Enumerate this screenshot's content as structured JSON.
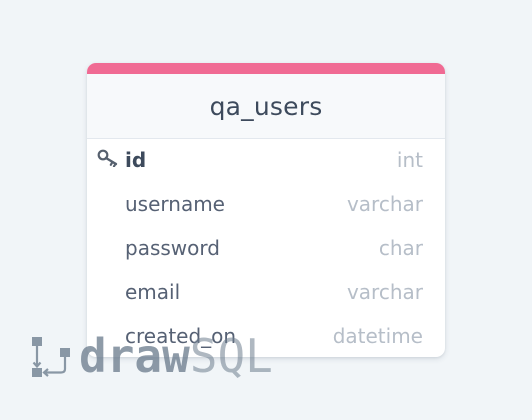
{
  "table": {
    "name": "qa_users",
    "accent_color": "#f06a93",
    "columns": [
      {
        "name": "id",
        "type": "int",
        "primary_key": true,
        "icon": "key-icon"
      },
      {
        "name": "username",
        "type": "varchar"
      },
      {
        "name": "password",
        "type": "char"
      },
      {
        "name": "email",
        "type": "varchar"
      },
      {
        "name": "created_on",
        "type": "datetime"
      }
    ]
  },
  "watermark": {
    "brand_bold": "draw",
    "brand_light": "SQL",
    "icon": "drawsql-logo-icon"
  }
}
